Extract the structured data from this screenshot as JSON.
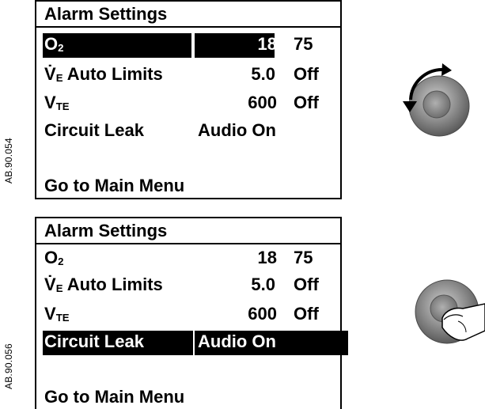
{
  "figure_codes": {
    "top": "AB.90.054",
    "bottom": "AB.90.056"
  },
  "panels": [
    {
      "title": "Alarm Settings",
      "rows": [
        {
          "name_main": "O",
          "name_sub": "2",
          "value_low": "18",
          "value_high": "75"
        },
        {
          "name_main": "V̇",
          "name_sub": "E",
          "name_rest": " Auto Limits",
          "value_low": "5.0",
          "value_high": "Off"
        },
        {
          "name_main": "V",
          "name_sub": "TE",
          "value_low": "600",
          "value_high": "Off"
        },
        {
          "name_main": "Circuit Leak",
          "value_wide": "Audio On"
        }
      ],
      "footer": "Go to Main Menu",
      "selected": "O2 low value (18)"
    },
    {
      "title": "Alarm Settings",
      "rows": [
        {
          "name_main": "O",
          "name_sub": "2",
          "value_low": "18",
          "value_high": "75"
        },
        {
          "name_main": "V̇",
          "name_sub": "E",
          "name_rest": " Auto Limits",
          "value_low": "5.0",
          "value_high": "Off"
        },
        {
          "name_main": "V",
          "name_sub": "TE",
          "value_low": "600",
          "value_high": "Off"
        },
        {
          "name_main": "Circuit Leak",
          "value_wide": "Audio On"
        }
      ],
      "footer": "Go to Main Menu",
      "selected": "Circuit Leak (Audio On)"
    }
  ],
  "controls": {
    "top_icon": "rotate-knob-icon",
    "bottom_icon": "press-knob-icon"
  }
}
